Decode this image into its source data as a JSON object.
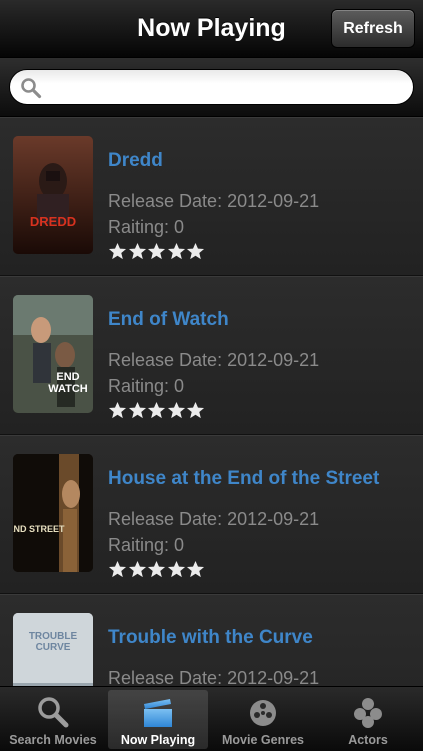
{
  "nav": {
    "title": "Now Playing",
    "refresh_label": "Refresh"
  },
  "search": {
    "placeholder": "",
    "value": "",
    "icon": "search-icon"
  },
  "movies": [
    {
      "title": "Dredd",
      "release": "Release Date: 2012-09-21",
      "rating": "Raiting: 0",
      "stars": 5,
      "poster": {
        "bg": "#3a1a14",
        "text": "DREDD",
        "text_color": "#d8321f"
      }
    },
    {
      "title": "End of Watch",
      "release": "Release Date: 2012-09-21",
      "rating": "Raiting: 0",
      "stars": 5,
      "poster": {
        "bg": "#3c4a3a",
        "text": "END WATCH",
        "text_color": "#ffffff"
      }
    },
    {
      "title": "House at the End of the Street",
      "release": "Release Date: 2012-09-21",
      "rating": "Raiting: 0",
      "stars": 5,
      "poster": {
        "bg": "#15110c",
        "text": "END STREET",
        "text_color": "#e8e0c0"
      }
    },
    {
      "title": "Trouble with the Curve",
      "release": "Release Date: 2012-09-21",
      "rating": "",
      "stars": 0,
      "poster": {
        "bg": "#c8d0d4",
        "text": "TROUBLE CURVE",
        "text_color": "#6e86a0"
      }
    }
  ],
  "tabs": [
    {
      "label": "Search Movies",
      "icon": "magnifier-icon",
      "active": false
    },
    {
      "label": "Now Playing",
      "icon": "clapperboard-icon",
      "active": true
    },
    {
      "label": "Movie Genres",
      "icon": "film-reel-icon",
      "active": false
    },
    {
      "label": "Actors",
      "icon": "people-icon",
      "active": false
    }
  ],
  "colors": {
    "title_blue": "#3f86c9",
    "text_gray": "#8a8a8a",
    "active_tab_icon": "#4fa3e8"
  }
}
